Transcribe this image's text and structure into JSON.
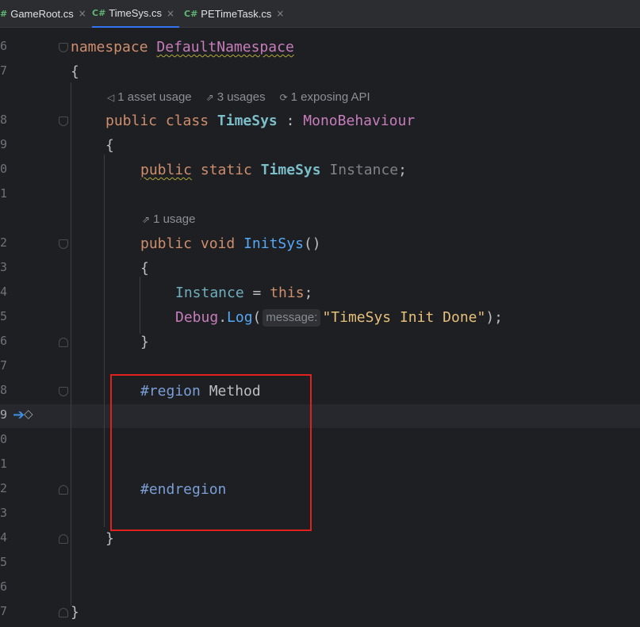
{
  "tabs": [
    {
      "icon": "#",
      "label": "GameRoot.cs",
      "close": "×"
    },
    {
      "icon": "C#",
      "label": "TimeSys.cs",
      "close": "×"
    },
    {
      "icon": "C#",
      "label": "PETimeTask.cs",
      "close": "×"
    }
  ],
  "line_numbers": [
    "6",
    "7",
    "",
    "8",
    "9",
    "0",
    "1",
    "",
    "2",
    "3",
    "4",
    "5",
    "6",
    "7",
    "8",
    "9",
    "0",
    "1",
    "2",
    "3",
    "4",
    "5",
    "6",
    "7"
  ],
  "hints": {
    "asset_usage": "1 asset usage",
    "usages_3": "3 usages",
    "exposing_api": "1 exposing API",
    "usage_1": "1 usage"
  },
  "code": {
    "l6_kw": "namespace",
    "l6_ns": "DefaultNamespace",
    "l7": "{",
    "l8_kw1": "public",
    "l8_kw2": "class",
    "l8_cls": "TimeSys",
    "l8_colon": ":",
    "l8_base": "MonoBehaviour",
    "l9": "{",
    "l10_kw1": "public",
    "l10_kw2": "static",
    "l10_type": "TimeSys",
    "l10_field": "Instance",
    "l10_semi": ";",
    "l12_kw1": "public",
    "l12_kw2": "void",
    "l12_fn": "InitSys",
    "l12_parens": "()",
    "l13": "{",
    "l14_field": "Instance",
    "l14_eq": " = ",
    "l14_this": "this",
    "l14_semi": ";",
    "l15_cls": "Debug",
    "l15_dot": ".",
    "l15_fn": "Log",
    "l15_open": "(",
    "l15_param": "message:",
    "l15_str": "\"TimeSys Init Done\"",
    "l15_close": ");",
    "l16": "}",
    "l18_region": "#region",
    "l18_name": "Method",
    "l22_endregion": "#endregion",
    "l24": "}",
    "l27": "}"
  },
  "icons": {
    "asset_usage_icon": "◁",
    "usages_icon": "⇗",
    "exposing_api_icon": "⟳",
    "usage_icon": "⇗",
    "execution_arrow": "➔",
    "breakpoint_diamond": "◇"
  },
  "colors": {
    "background": "#1e1f22",
    "keyword": "#cf8e6d",
    "class": "#c77dbb",
    "string": "#e6c07b",
    "highlight_box": "#e0201d"
  }
}
